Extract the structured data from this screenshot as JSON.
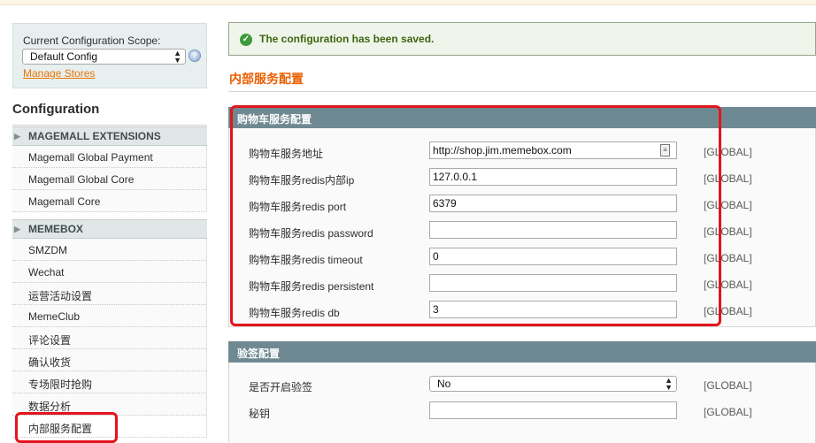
{
  "sidebar": {
    "scope_label": "Current Configuration Scope:",
    "scope_value": "Default Config",
    "manage_stores": "Manage Stores",
    "config_title": "Configuration",
    "groups": [
      {
        "title": "MAGEMALL EXTENSIONS",
        "items": [
          "Magemall Global Payment",
          "Magemall Global Core",
          "Magemall Core"
        ]
      },
      {
        "title": "MEMEBOX",
        "items": [
          "SMZDM",
          "Wechat",
          "运营活动设置",
          "MemeClub",
          "评论设置",
          "确认收货",
          "专场限时抢购",
          "数据分析",
          "内部服务配置"
        ]
      }
    ],
    "active_item": "内部服务配置"
  },
  "message": "The configuration has been saved.",
  "page_title": "内部服务配置",
  "sections": [
    {
      "title": "购物车服务配置",
      "fields": [
        {
          "label": "购物车服务地址",
          "value": "http://shop.jim.memebox.com",
          "scope": "[GLOBAL]"
        },
        {
          "label": "购物车服务redis内部ip",
          "value": "127.0.0.1",
          "scope": "[GLOBAL]"
        },
        {
          "label": "购物车服务redis port",
          "value": "6379",
          "scope": "[GLOBAL]"
        },
        {
          "label": "购物车服务redis password",
          "value": "",
          "scope": "[GLOBAL]"
        },
        {
          "label": "购物车服务redis timeout",
          "value": "0",
          "scope": "[GLOBAL]"
        },
        {
          "label": "购物车服务redis persistent",
          "value": "",
          "scope": "[GLOBAL]"
        },
        {
          "label": "购物车服务redis db",
          "value": "3",
          "scope": "[GLOBAL]"
        }
      ]
    },
    {
      "title": "验签配置",
      "fields": [
        {
          "label": "是否开启验签",
          "value": "No",
          "scope": "[GLOBAL]"
        },
        {
          "label": "秘钥",
          "value": "",
          "scope": "[GLOBAL]"
        }
      ]
    }
  ],
  "colors": {
    "accent_orange": "#eb5e00",
    "section_header": "#6f8992",
    "success_text": "#3d6611",
    "highlight_red": "#e3141c"
  }
}
